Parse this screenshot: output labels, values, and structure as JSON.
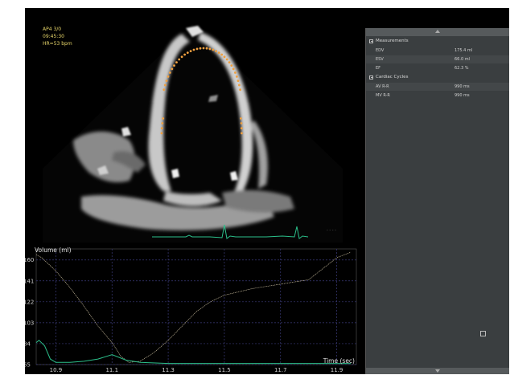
{
  "overlay": {
    "line1": "AP4 3/0",
    "line2": "09:45:30",
    "line3": "HR=53 bpm"
  },
  "panel": {
    "sections": [
      {
        "title": "Measurements",
        "rows": [
          {
            "label": "EDV",
            "value": "175.4 ml"
          },
          {
            "label": "ESV",
            "value": "66.0 ml"
          },
          {
            "label": "EF",
            "value": "62.3 %"
          }
        ]
      },
      {
        "title": "Cardiac Cycles",
        "rows": [
          {
            "label": "AV R-R",
            "value": "990 ms"
          },
          {
            "label": "MV R-R",
            "value": "990 ms"
          }
        ]
      }
    ]
  },
  "colors": {
    "ecg": "#2bbf8a",
    "contour": "#f0a040",
    "volume_curve": "#e0d2b0",
    "grid": "#3b3b7a",
    "panel_bg": "#3a3e40"
  },
  "chart_data": {
    "type": "line",
    "title": "",
    "ylabel": "Volume (ml)",
    "xlabel": "Time (sec)",
    "x_ticks": [
      "10.9",
      "11.1",
      "11.3",
      "11.5",
      "11.7",
      "11.9"
    ],
    "y_ticks": [
      "160",
      "141",
      "122",
      "103",
      "84",
      "65"
    ],
    "xlim": [
      10.83,
      11.97
    ],
    "ylim": [
      65,
      170
    ],
    "series": [
      {
        "role": "volume",
        "x": [
          10.83,
          10.85,
          10.9,
          10.95,
          11.0,
          11.05,
          11.1,
          11.13,
          11.16,
          11.2,
          11.25,
          11.3,
          11.35,
          11.4,
          11.45,
          11.5,
          11.55,
          11.6,
          11.65,
          11.7,
          11.75,
          11.8,
          11.85,
          11.9,
          11.95
        ],
        "y": [
          165,
          162,
          150,
          135,
          118,
          100,
          85,
          73,
          67,
          68,
          76,
          87,
          100,
          113,
          122,
          128,
          131,
          134,
          136,
          138,
          140,
          142,
          152,
          162,
          167
        ]
      },
      {
        "role": "green",
        "x": [
          10.83,
          10.84,
          10.86,
          10.88,
          10.9,
          10.95,
          11.0,
          11.05,
          11.1,
          11.15,
          11.2,
          11.3,
          11.5,
          11.7,
          11.9,
          11.95
        ],
        "y": [
          85,
          87,
          82,
          70,
          67,
          67,
          68,
          70,
          74,
          69,
          67,
          66,
          66,
          66,
          66,
          66
        ]
      }
    ]
  }
}
